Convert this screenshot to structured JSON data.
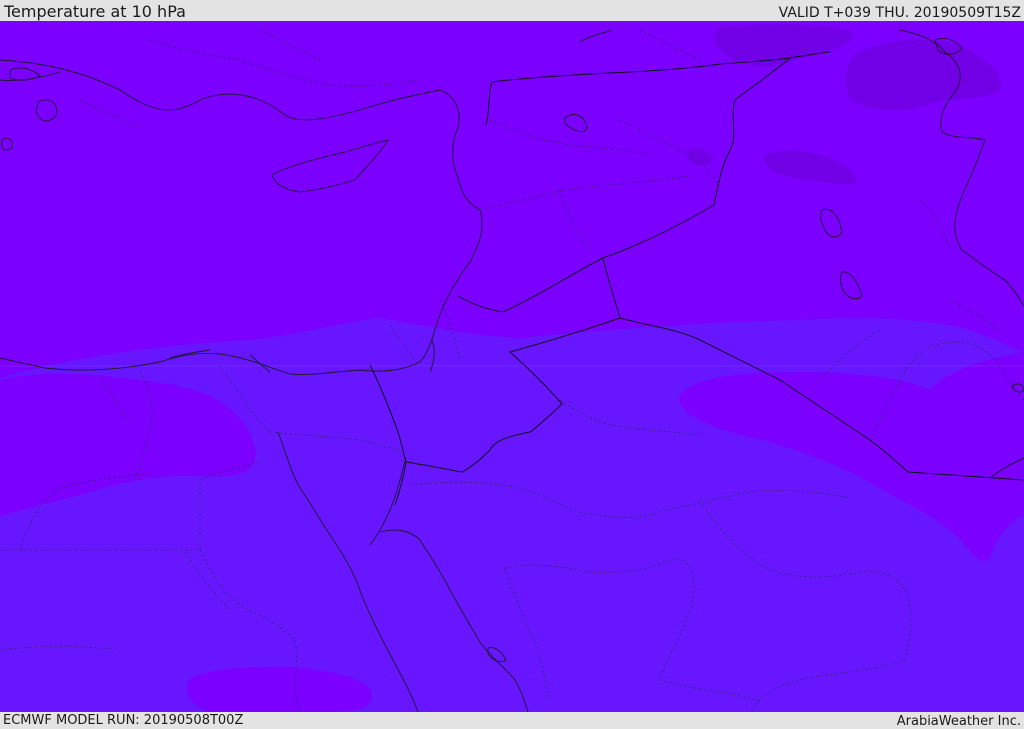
{
  "header": {
    "title": "Temperature at 10 hPa",
    "valid": "VALID T+039 THU. 20190509T15Z"
  },
  "footer": {
    "model_run": "ECMWF MODEL RUN: 20190508T00Z",
    "brand": "ArabiaWeather Inc."
  },
  "map": {
    "field": "temperature",
    "level": "10 hPa",
    "region": "Eastern Mediterranean / Middle East",
    "colors": {
      "warm_violet": "#7c00ff",
      "cool_indigo": "#6716ff",
      "dark_violet": "#7100e6",
      "coastline": "#1a1a2e",
      "border_dotted": "#2a2a5a"
    },
    "overlays": [
      "coastlines",
      "international-borders",
      "province-borders"
    ]
  }
}
